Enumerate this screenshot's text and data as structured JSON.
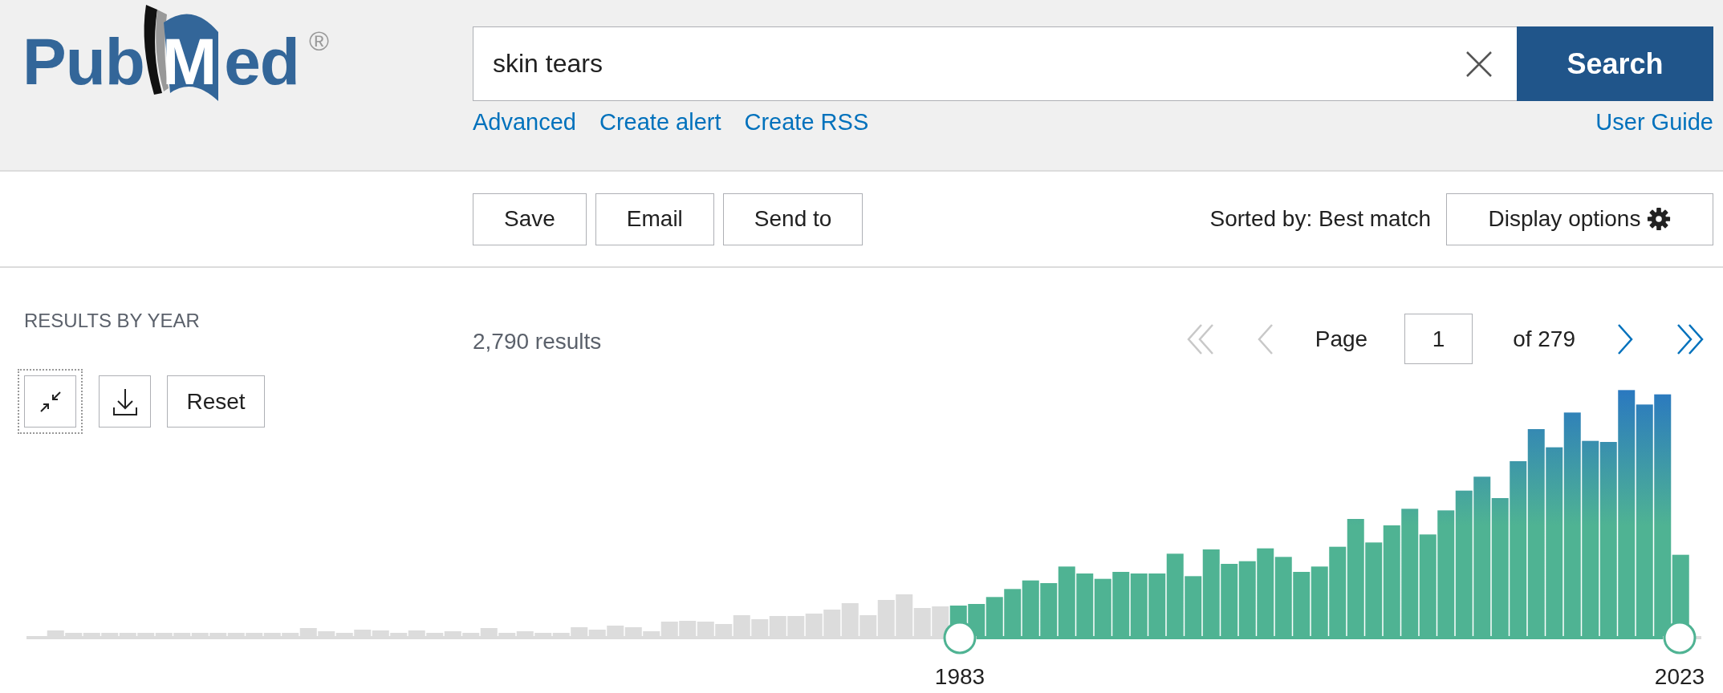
{
  "logo": {
    "text": "PubMed",
    "mark": "®"
  },
  "search": {
    "value": "skin tears",
    "button": "Search"
  },
  "links": [
    {
      "label": "Advanced"
    },
    {
      "label": "Create alert"
    },
    {
      "label": "Create RSS"
    }
  ],
  "help_link": "User Guide",
  "actions": [
    "Save",
    "Email",
    "Send to"
  ],
  "sort": "Sorted by: Best match",
  "display_options": "Display options",
  "timeline": {
    "title": "RESULTS BY YEAR",
    "controls": [
      {
        "kind": "collapse",
        "focused": true
      },
      {
        "kind": "download",
        "focused": false
      },
      {
        "kind": "reset",
        "label": "Reset",
        "focused": false
      }
    ],
    "range_start": "1983",
    "range_end": "2023"
  },
  "results": {
    "count": "2,790 results",
    "page_label": "Page",
    "page": "1",
    "page_total": "of 279",
    "nav": [
      {
        "kind": "first",
        "disabled": true
      },
      {
        "kind": "previous",
        "disabled": true
      },
      {
        "kind": "next",
        "disabled": false
      },
      {
        "kind": "last",
        "disabled": false
      }
    ]
  }
}
